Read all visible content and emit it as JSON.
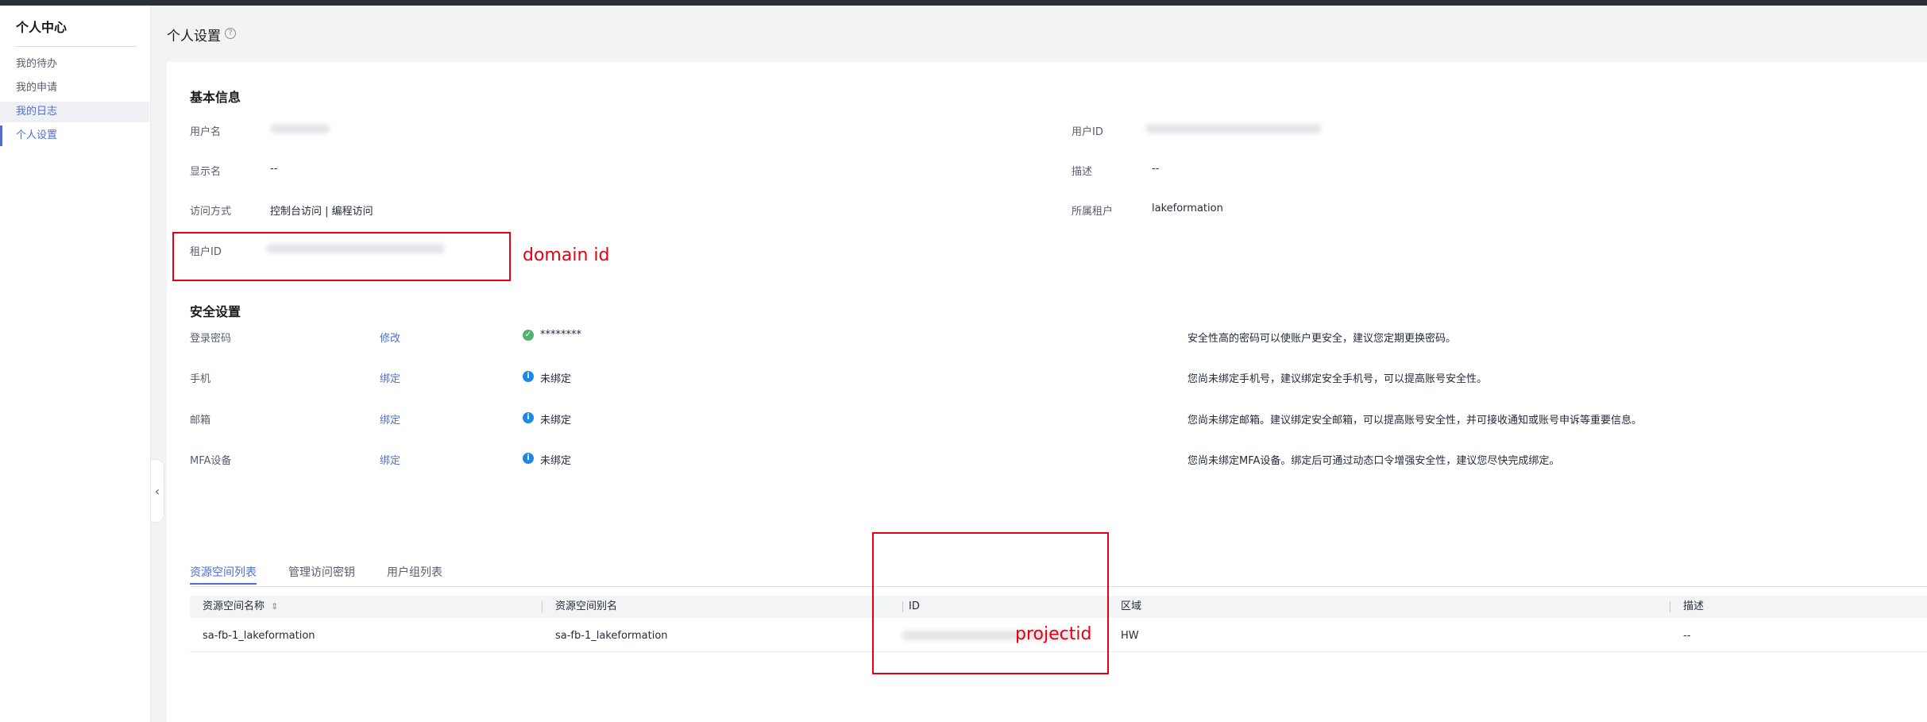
{
  "sidebar": {
    "title": "个人中心",
    "items": [
      {
        "label": "我的待办"
      },
      {
        "label": "我的申请"
      },
      {
        "label": "我的日志"
      },
      {
        "label": "个人设置"
      }
    ],
    "collapse_glyph": "‹"
  },
  "header": {
    "title": "个人设置",
    "help_glyph": "?"
  },
  "basic_info": {
    "title": "基本信息",
    "username_label": "用户名",
    "userid_label": "用户ID",
    "display_name_label": "显示名",
    "display_name_value": "--",
    "description_label": "描述",
    "description_value": "--",
    "access_label": "访问方式",
    "access_value": "控制台访问 | 编程访问",
    "tenant_label": "所属租户",
    "tenant_value": "lakeformation",
    "tenant_id_label": "租户ID"
  },
  "security": {
    "title": "安全设置",
    "rows": [
      {
        "label": "登录密码",
        "action": "修改",
        "status": "********",
        "hint": "安全性高的密码可以使账户更安全，建议您定期更换密码。"
      },
      {
        "label": "手机",
        "action": "绑定",
        "status": "未绑定",
        "hint": "您尚未绑定手机号，建议绑定安全手机号，可以提高账号安全性。"
      },
      {
        "label": "邮箱",
        "action": "绑定",
        "status": "未绑定",
        "hint": "您尚未绑定邮箱。建议绑定安全邮箱，可以提高账号安全性，并可接收通知或账号申诉等重要信息。"
      },
      {
        "label": "MFA设备",
        "action": "绑定",
        "status": "未绑定",
        "hint": "您尚未绑定MFA设备。绑定后可通过动态口令增强安全性，建议您尽快完成绑定。"
      }
    ]
  },
  "tabs": [
    {
      "label": "资源空间列表"
    },
    {
      "label": "管理访问密钥"
    },
    {
      "label": "用户组列表"
    }
  ],
  "table": {
    "headers": [
      "资源空间名称",
      "资源空间别名",
      "ID",
      "区域",
      "描述"
    ],
    "rows": [
      {
        "name": "sa-fb-1_lakeformation",
        "alias": "sa-fb-1_lakeformation",
        "region": "HW",
        "desc": "--"
      }
    ]
  },
  "annotations": {
    "domain_id": "domain id",
    "project_id": "projectid"
  },
  "colors": {
    "accent": "#526ecc",
    "annotation": "#e60012",
    "ok": "#50b371",
    "info": "#1e88e5"
  }
}
